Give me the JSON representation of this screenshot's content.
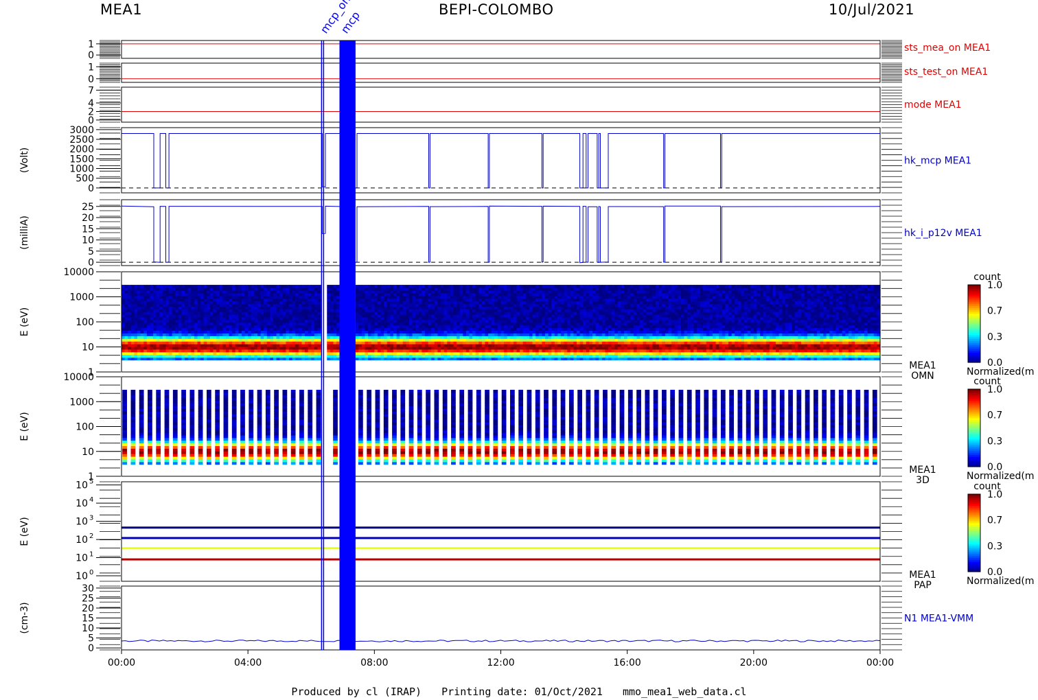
{
  "header": {
    "left": "MEA1",
    "center": "BEPI-COLOMBO",
    "right": "10/Jul/2021"
  },
  "footer": {
    "produced_by": "Produced by cl (IRAP)",
    "printing_date": "Printing date: 01/Oct/2021",
    "script_name": "mmo_mea1_web_data.cl"
  },
  "overlay_labels": [
    "mcp_on",
    "mcp"
  ],
  "colors": {
    "red": "#e00000",
    "blue": "#0000cc",
    "dark_blue": "#00008b",
    "gap_blue": "#0000ff"
  },
  "chart_data": {
    "type": "line",
    "x_axis": {
      "unit": "hours",
      "range": [
        0,
        24
      ],
      "ticks": [
        0,
        4,
        8,
        12,
        16,
        20,
        24
      ],
      "tick_labels": [
        "00:00",
        "04:00",
        "08:00",
        "12:00",
        "16:00",
        "20:00",
        "00:00"
      ]
    },
    "data_gaps_hours": [
      [
        6.35,
        6.45
      ],
      [
        6.95,
        7.35
      ]
    ],
    "panels": [
      {
        "id": "sts_mea_on",
        "type": "line",
        "label": "sts_mea_on MEA1",
        "ylabel": "",
        "ylim": [
          -0.3,
          1.3
        ],
        "yticks": [
          1,
          0
        ],
        "ytick_labels": [
          "1",
          "0"
        ],
        "color": "#e00000",
        "series": [
          {
            "x": [
              0,
              6.35,
              6.45,
              24
            ],
            "y": [
              1,
              1,
              1,
              1
            ]
          }
        ]
      },
      {
        "id": "sts_test_on",
        "type": "line",
        "label": "sts_test_on MEA1",
        "ylabel": "",
        "ylim": [
          -0.3,
          1.3
        ],
        "yticks": [
          1,
          0
        ],
        "ytick_labels": [
          "1",
          "0"
        ],
        "color": "#e00000",
        "series": [
          {
            "x": [
              0,
              24
            ],
            "y": [
              0,
              0
            ]
          }
        ]
      },
      {
        "id": "mode",
        "type": "line",
        "label": "mode MEA1",
        "ylabel": "",
        "ylim": [
          -0.5,
          7.7
        ],
        "yticks": [
          7,
          4,
          2,
          0
        ],
        "ytick_labels": [
          "7",
          "4",
          "2",
          "0"
        ],
        "color": "#e00000",
        "series": [
          {
            "x": [
              0,
              24
            ],
            "y": [
              2,
              2
            ]
          }
        ]
      },
      {
        "id": "hk_mcp",
        "type": "line",
        "label": "hk_mcp MEA1",
        "ylabel": "(Volt)",
        "ylim": [
          -250,
          3100
        ],
        "yticks": [
          3000,
          2500,
          2000,
          1500,
          1000,
          500,
          0
        ],
        "ytick_labels": [
          "3000",
          "2500",
          "2000",
          "1500",
          "1000",
          "500",
          "0"
        ],
        "color": "#0000cc",
        "baseline": 0,
        "nominal": 2800,
        "dropouts_hours": [
          [
            1.02,
            1.22
          ],
          [
            1.4,
            1.5
          ],
          [
            6.35,
            6.45
          ],
          [
            7.35,
            7.45
          ],
          [
            9.72,
            9.76
          ],
          [
            11.6,
            11.64
          ],
          [
            13.3,
            13.34
          ],
          [
            14.5,
            14.6
          ],
          [
            14.7,
            14.76
          ],
          [
            15.05,
            15.1
          ],
          [
            15.15,
            15.4
          ],
          [
            17.15,
            17.19
          ],
          [
            18.95,
            18.99
          ]
        ],
        "gap_value": 60
      },
      {
        "id": "hk_i_p12v",
        "type": "line",
        "label": "hk_i_p12v MEA1",
        "ylabel": "(milliA)",
        "ylim": [
          -1.5,
          28
        ],
        "yticks": [
          25,
          20,
          15,
          10,
          5,
          0
        ],
        "ytick_labels": [
          "25",
          "20",
          "15",
          "10",
          "5",
          "0"
        ],
        "color": "#0000cc",
        "baseline": 0,
        "nominal": 25,
        "dropouts_hours": [
          [
            1.02,
            1.22
          ],
          [
            1.4,
            1.5
          ],
          [
            6.35,
            6.45
          ],
          [
            7.35,
            7.45
          ],
          [
            9.72,
            9.76
          ],
          [
            11.6,
            11.64
          ],
          [
            13.3,
            13.34
          ],
          [
            14.5,
            14.6
          ],
          [
            14.7,
            14.76
          ],
          [
            15.05,
            15.1
          ],
          [
            15.15,
            15.4
          ],
          [
            17.15,
            17.19
          ],
          [
            18.95,
            18.99
          ]
        ],
        "gap_value": 13
      },
      {
        "id": "omn",
        "type": "heatmap",
        "label": [
          "MEA1",
          "OMN"
        ],
        "ylabel": "E (eV)",
        "scale": "log",
        "ylim": [
          1,
          10000
        ],
        "yticks": [
          10000,
          1000,
          100,
          10,
          1
        ],
        "ytick_labels": [
          "10000",
          "1000",
          "100",
          "10",
          "1"
        ],
        "energy_range_eV": [
          3,
          3000
        ],
        "colorbar": {
          "title": "count",
          "min": 0.0,
          "max": 1.0,
          "ticks": [
            "1.0",
            "0.7",
            "0.3",
            "0.0"
          ],
          "label": "Normalized(m"
        }
      },
      {
        "id": "3d",
        "type": "heatmap",
        "label": [
          "MEA1",
          "3D"
        ],
        "ylabel": "E (eV)",
        "scale": "log",
        "ylim": [
          1,
          10000
        ],
        "yticks": [
          10000,
          1000,
          100,
          10,
          1
        ],
        "ytick_labels": [
          "10000",
          "1000",
          "100",
          "10",
          "1"
        ],
        "energy_range_eV": [
          3,
          3000
        ],
        "stripe_count": 90,
        "colorbar": {
          "title": "count",
          "min": 0.0,
          "max": 1.0,
          "ticks": [
            "1.0",
            "0.7",
            "0.3",
            "0.0"
          ],
          "label": "Normalized(m"
        }
      },
      {
        "id": "pap",
        "type": "heatmap",
        "label": [
          "MEA1",
          "PAP"
        ],
        "ylabel": "E (eV)",
        "scale": "log",
        "ylim": [
          0.5,
          150000
        ],
        "yticks": [
          100000,
          10000,
          1000,
          100,
          10,
          1
        ],
        "ytick_labels": [
          "10",
          "10",
          "10",
          "10",
          "10",
          "10"
        ],
        "ytick_exponents": [
          "5",
          "4",
          "3",
          "2",
          "1",
          "0"
        ],
        "lines": [
          {
            "energy_eV": 450,
            "value": 0.0
          },
          {
            "energy_eV": 120,
            "value": 0.05
          },
          {
            "energy_eV": 33,
            "value": 0.6
          },
          {
            "energy_eV": 8,
            "value": 0.95
          }
        ],
        "colorbar": {
          "title": "count",
          "min": 0.0,
          "max": 1.0,
          "ticks": [
            "1.0",
            "0.7",
            "0.3",
            "0.0"
          ],
          "label": "Normalized(m"
        }
      },
      {
        "id": "n1",
        "type": "line",
        "label": "N1 MEA1-VMM",
        "ylabel": "(cm-3)",
        "ylim": [
          -1,
          31
        ],
        "yticks": [
          30,
          25,
          20,
          15,
          10,
          5,
          0
        ],
        "ytick_labels": [
          "30",
          "25",
          "20",
          "15",
          "10",
          "5",
          "0"
        ],
        "color": "#0000cc",
        "baseline": 3.5
      }
    ]
  }
}
